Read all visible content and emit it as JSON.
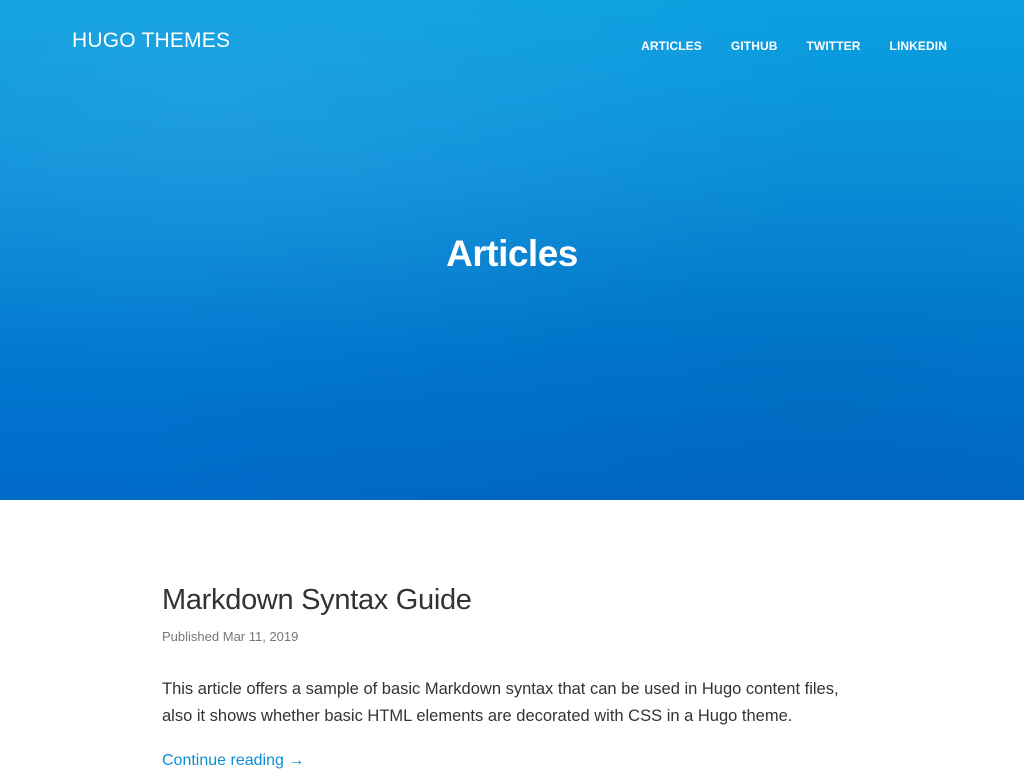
{
  "site": {
    "brand": "HUGO THEMES"
  },
  "nav": {
    "items": [
      {
        "label": "ARTICLES"
      },
      {
        "label": "GITHUB"
      },
      {
        "label": "TWITTER"
      },
      {
        "label": "LINKEDIN"
      }
    ]
  },
  "hero": {
    "title": "Articles"
  },
  "post": {
    "title": "Markdown Syntax Guide",
    "meta_prefix": "Published",
    "date": "Mar 11, 2019",
    "summary": "This article offers a sample of basic Markdown syntax that can be used in Hugo content files, also it shows whether basic HTML elements are decorated with CSS in a Hugo theme.",
    "continue_label": "Continue reading →"
  },
  "colors": {
    "hero_top": "#0aa0e0",
    "hero_bottom": "#006ac8",
    "link": "#0a8fd6"
  }
}
